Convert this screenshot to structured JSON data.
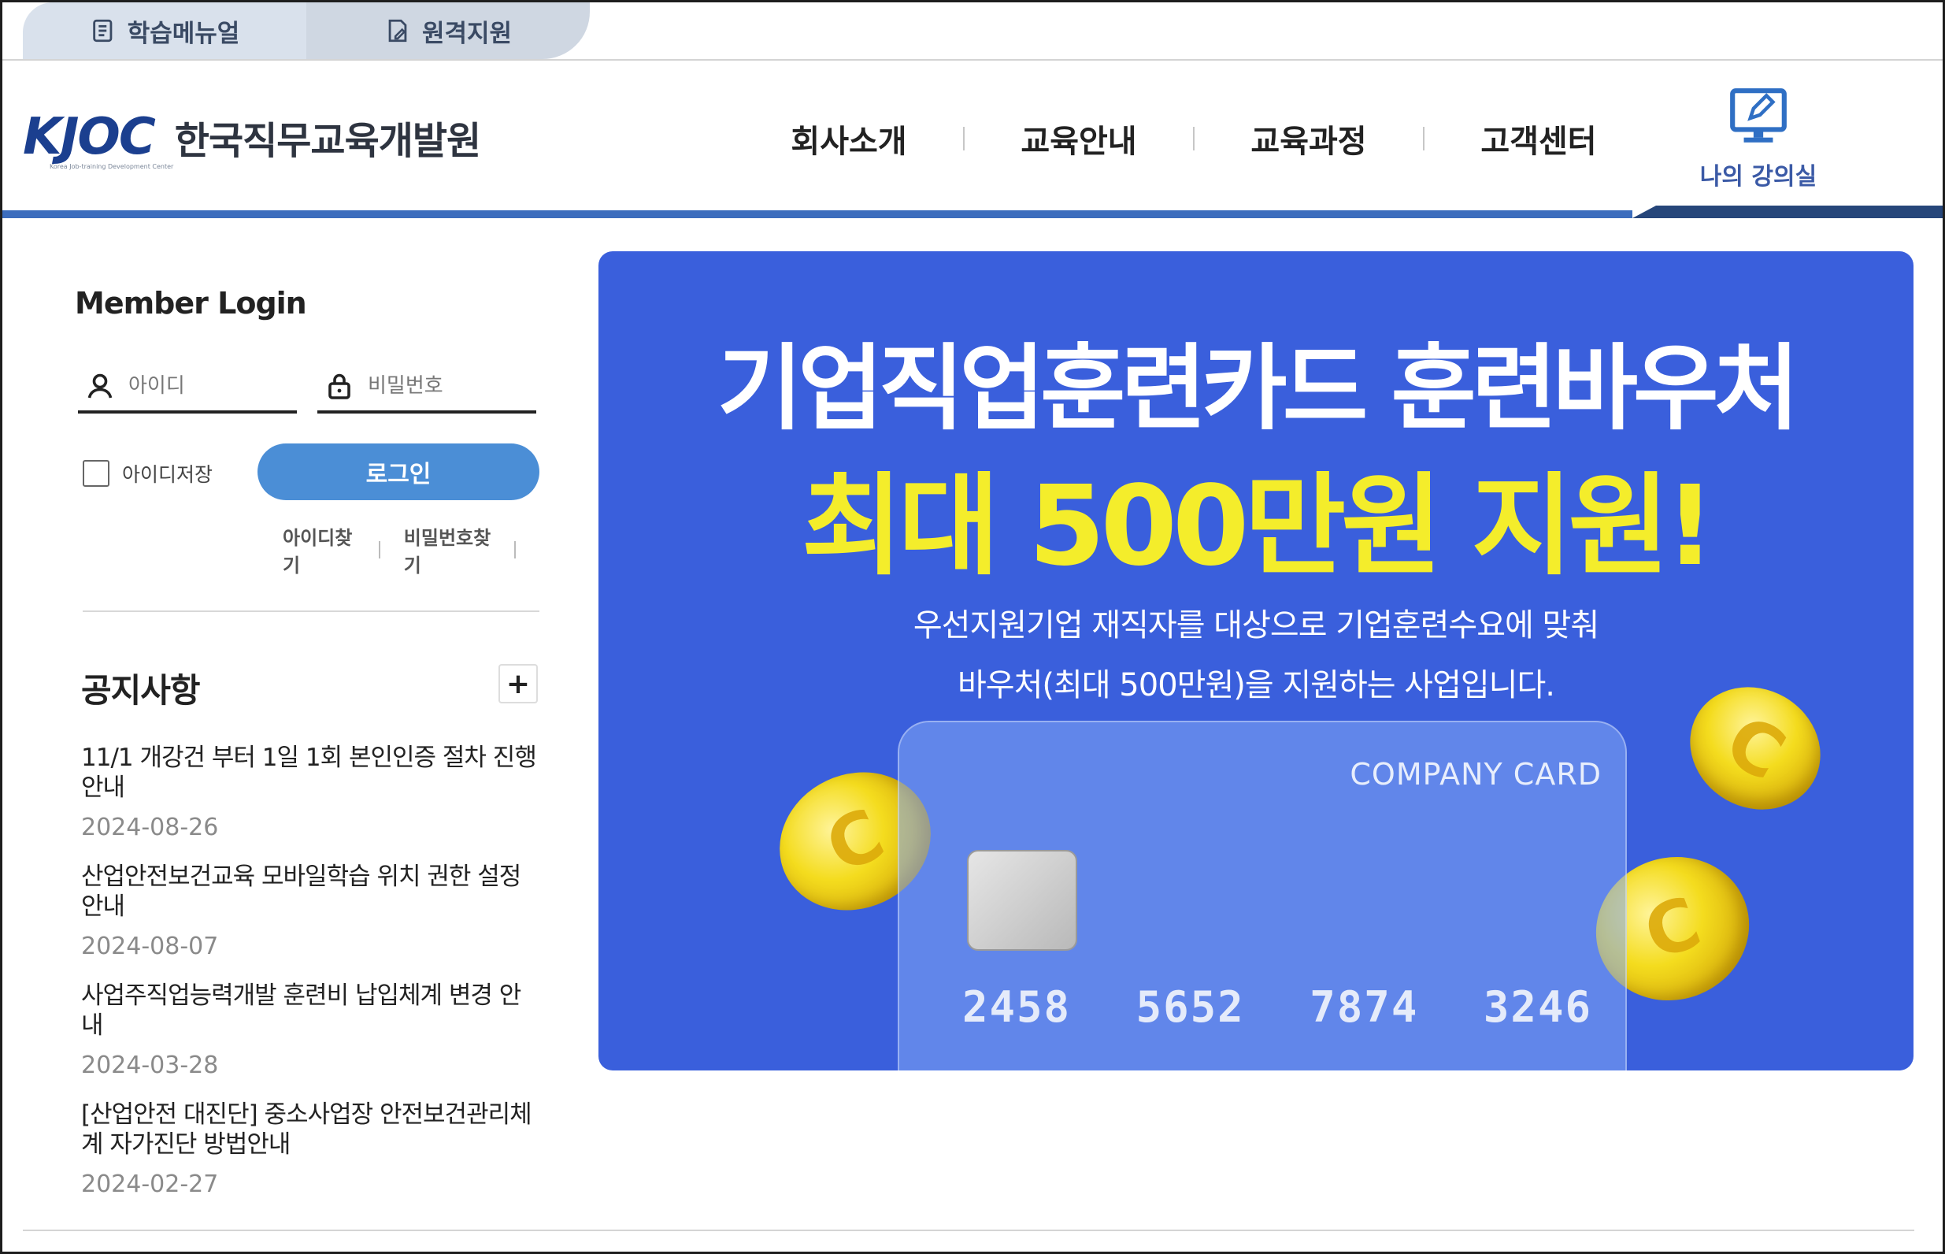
{
  "topbar": {
    "tabs": [
      {
        "label": "학습메뉴얼",
        "icon": "document-icon"
      },
      {
        "label": "원격지원",
        "icon": "remote-support-icon"
      }
    ]
  },
  "header": {
    "logo_mark": "KJOC",
    "logo_sub": "Korea Job-training Development Center",
    "logo_text": "한국직무교육개발원",
    "nav": [
      "회사소개",
      "교육안내",
      "교육과정",
      "고객센터"
    ],
    "lecture_room": "나의 강의실",
    "colors": {
      "accent": "#3c6dbd",
      "dark": "#26467a",
      "logo": "#1b3f8f"
    }
  },
  "login": {
    "title": "Member Login",
    "id_placeholder": "아이디",
    "pw_placeholder": "비밀번호",
    "remember_label": "아이디저장",
    "login_button": "로그인",
    "find_id": "아이디찾기",
    "find_pw": "비밀번호찾기"
  },
  "notice": {
    "title": "공지사항",
    "more": "+",
    "items": [
      {
        "title": "11/1 개강건 부터 1일 1회 본인인증 절차 진행안내",
        "date": "2024-08-26"
      },
      {
        "title": "산업안전보건교육 모바일학습 위치 권한 설정 안내",
        "date": "2024-08-07"
      },
      {
        "title": "사업주직업능력개발 훈련비 납입체계 변경 안내",
        "date": "2024-03-28"
      },
      {
        "title": "[산업안전 대진단] 중소사업장 안전보건관리체계 자가진단 방법안내",
        "date": "2024-02-27"
      }
    ]
  },
  "banner": {
    "title": "기업직업훈련카드 훈련바우처",
    "subtitle": "최대 500만원 지원!",
    "desc1": "우선지원기업 재직자를 대상으로 기업훈련수요에 맞춰",
    "desc2": "바우처(최대 500만원)을 지원하는 사업입니다.",
    "card_label": "COMPANY CARD",
    "card_numbers": [
      "2458",
      "5652",
      "7874",
      "3246"
    ],
    "colors": {
      "background": "#3a5fdc",
      "highlight": "#f4ed2b"
    }
  }
}
